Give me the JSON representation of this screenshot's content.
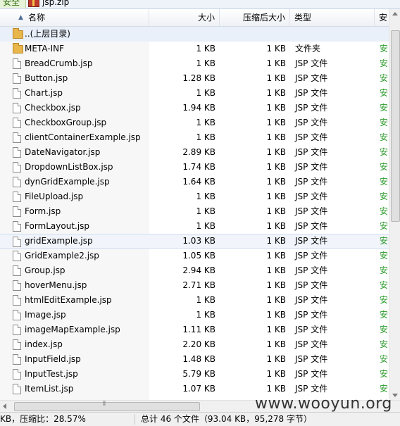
{
  "topbar": {
    "secure_label": "安全",
    "archive_name": "jsp.zip"
  },
  "columns": {
    "name": "名称",
    "size": "大小",
    "compressed": "压缩后大小",
    "type": "类型",
    "security": "安"
  },
  "parent_row": {
    "name": "..(上层目录)"
  },
  "rows": [
    {
      "name": "META-INF",
      "size": "1 KB",
      "compressed": "1 KB",
      "type": "文件夹",
      "security": "安",
      "kind": "folder"
    },
    {
      "name": "BreadCrumb.jsp",
      "size": "1 KB",
      "compressed": "1 KB",
      "type": "JSP 文件",
      "security": "安",
      "kind": "file"
    },
    {
      "name": "Button.jsp",
      "size": "1.28 KB",
      "compressed": "1 KB",
      "type": "JSP 文件",
      "security": "安",
      "kind": "file"
    },
    {
      "name": "Chart.jsp",
      "size": "1 KB",
      "compressed": "1 KB",
      "type": "JSP 文件",
      "security": "安",
      "kind": "file"
    },
    {
      "name": "Checkbox.jsp",
      "size": "1.94 KB",
      "compressed": "1 KB",
      "type": "JSP 文件",
      "security": "安",
      "kind": "file"
    },
    {
      "name": "CheckboxGroup.jsp",
      "size": "1 KB",
      "compressed": "1 KB",
      "type": "JSP 文件",
      "security": "安",
      "kind": "file"
    },
    {
      "name": "clientContainerExample.jsp",
      "size": "1 KB",
      "compressed": "1 KB",
      "type": "JSP 文件",
      "security": "安",
      "kind": "file"
    },
    {
      "name": "DateNavigator.jsp",
      "size": "2.89 KB",
      "compressed": "1 KB",
      "type": "JSP 文件",
      "security": "安",
      "kind": "file"
    },
    {
      "name": "DropdownListBox.jsp",
      "size": "1.74 KB",
      "compressed": "1 KB",
      "type": "JSP 文件",
      "security": "安",
      "kind": "file"
    },
    {
      "name": "dynGridExample.jsp",
      "size": "1.64 KB",
      "compressed": "1 KB",
      "type": "JSP 文件",
      "security": "安",
      "kind": "file"
    },
    {
      "name": "FileUpload.jsp",
      "size": "1 KB",
      "compressed": "1 KB",
      "type": "JSP 文件",
      "security": "安",
      "kind": "file"
    },
    {
      "name": "Form.jsp",
      "size": "1 KB",
      "compressed": "1 KB",
      "type": "JSP 文件",
      "security": "安",
      "kind": "file"
    },
    {
      "name": "FormLayout.jsp",
      "size": "1 KB",
      "compressed": "1 KB",
      "type": "JSP 文件",
      "security": "安",
      "kind": "file"
    },
    {
      "name": "gridExample.jsp",
      "size": "1.03 KB",
      "compressed": "1 KB",
      "type": "JSP 文件",
      "security": "安",
      "kind": "file",
      "selected": true
    },
    {
      "name": "GridExample2.jsp",
      "size": "1.05 KB",
      "compressed": "1 KB",
      "type": "JSP 文件",
      "security": "安",
      "kind": "file"
    },
    {
      "name": "Group.jsp",
      "size": "2.94 KB",
      "compressed": "1 KB",
      "type": "JSP 文件",
      "security": "安",
      "kind": "file"
    },
    {
      "name": "hoverMenu.jsp",
      "size": "2.71 KB",
      "compressed": "1 KB",
      "type": "JSP 文件",
      "security": "安",
      "kind": "file"
    },
    {
      "name": "htmlEditExample.jsp",
      "size": "1 KB",
      "compressed": "1 KB",
      "type": "JSP 文件",
      "security": "安",
      "kind": "file"
    },
    {
      "name": "Image.jsp",
      "size": "1 KB",
      "compressed": "1 KB",
      "type": "JSP 文件",
      "security": "安",
      "kind": "file"
    },
    {
      "name": "imageMapExample.jsp",
      "size": "1.11 KB",
      "compressed": "1 KB",
      "type": "JSP 文件",
      "security": "安",
      "kind": "file"
    },
    {
      "name": "index.jsp",
      "size": "2.20 KB",
      "compressed": "1 KB",
      "type": "JSP 文件",
      "security": "安",
      "kind": "file"
    },
    {
      "name": "InputField.jsp",
      "size": "1.48 KB",
      "compressed": "1 KB",
      "type": "JSP 文件",
      "security": "安",
      "kind": "file"
    },
    {
      "name": "InputTest.jsp",
      "size": "5.79 KB",
      "compressed": "1 KB",
      "type": "JSP 文件",
      "security": "安",
      "kind": "file"
    },
    {
      "name": "ItemList.jsp",
      "size": "1.07 KB",
      "compressed": "1 KB",
      "type": "JSP 文件",
      "security": "安",
      "kind": "file"
    }
  ],
  "status": {
    "left": "KB，压缩比：28.57%",
    "total": "总计 46 个文件（93.04 KB，95,278 字节）"
  },
  "watermark": "www.wooyun.org"
}
